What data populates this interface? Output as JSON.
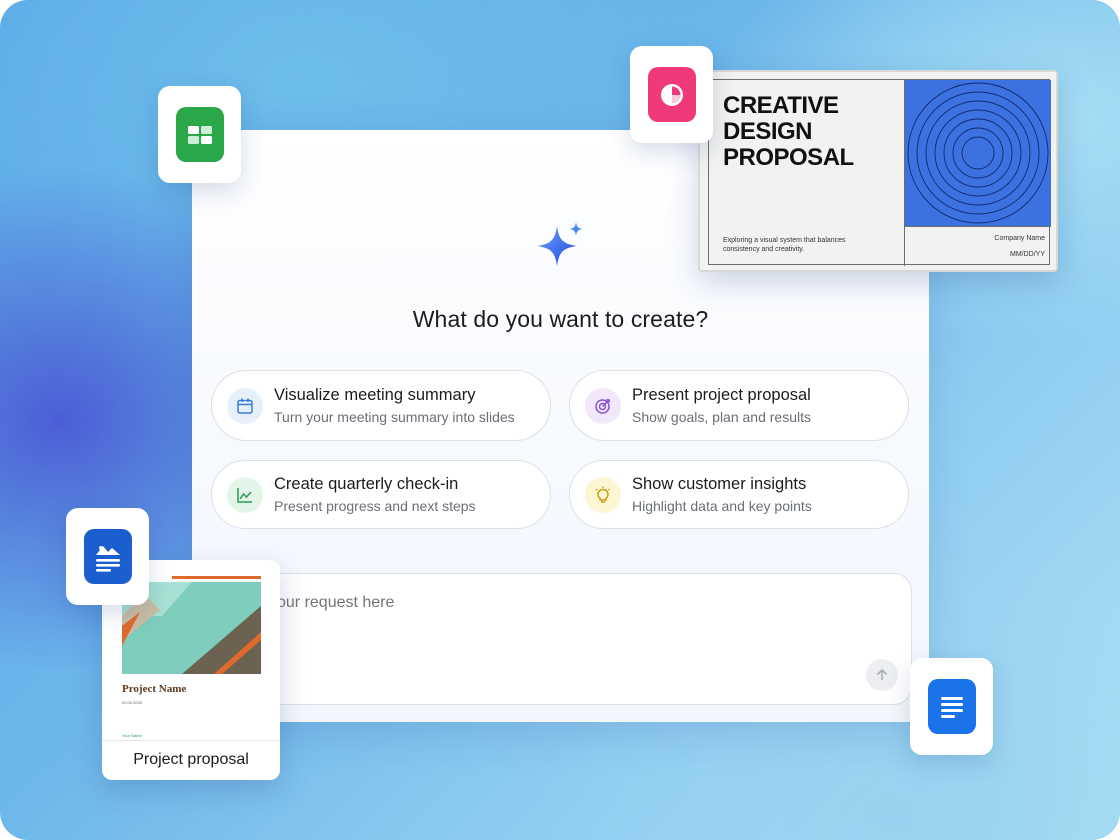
{
  "prompt": {
    "heading": "What do you want to create?",
    "placeholder": "our request here"
  },
  "suggestions": [
    {
      "title": "Visualize meeting summary",
      "subtitle": "Turn your meeting summary into slides",
      "icon": "calendar-icon",
      "icon_color": "#3a7bd5",
      "icon_bg": "#e6f0fb"
    },
    {
      "title": "Present project proposal",
      "subtitle": "Show goals, plan and results",
      "icon": "target-icon",
      "icon_color": "#8a4fd6",
      "icon_bg": "#f1e9fb"
    },
    {
      "title": "Create quarterly check-in",
      "subtitle": "Present progress and next steps",
      "icon": "chart-line-icon",
      "icon_color": "#2e9a55",
      "icon_bg": "#e3f5e8"
    },
    {
      "title": "Show customer insights",
      "subtitle": "Highlight data and key points",
      "icon": "lightbulb-icon",
      "icon_color": "#c99a12",
      "icon_bg": "#fdf6d3"
    }
  ],
  "proposal_slide": {
    "title_lines": [
      "CREATIVE",
      "DESIGN",
      "PROPOSAL"
    ],
    "description": "Exploring a visual system that balances consistency and creativity.",
    "company": "Company Name",
    "date": "MM/DD/YY"
  },
  "doc_card": {
    "project_name": "Project Name",
    "date": "00.00.2000",
    "owner": "Your Name",
    "label": "Project proposal"
  },
  "app_icons": {
    "sheets": "#2aa84a",
    "slides": "#f0397a",
    "docs_image": "#1b5fcf",
    "docs": "#1a73e8"
  }
}
